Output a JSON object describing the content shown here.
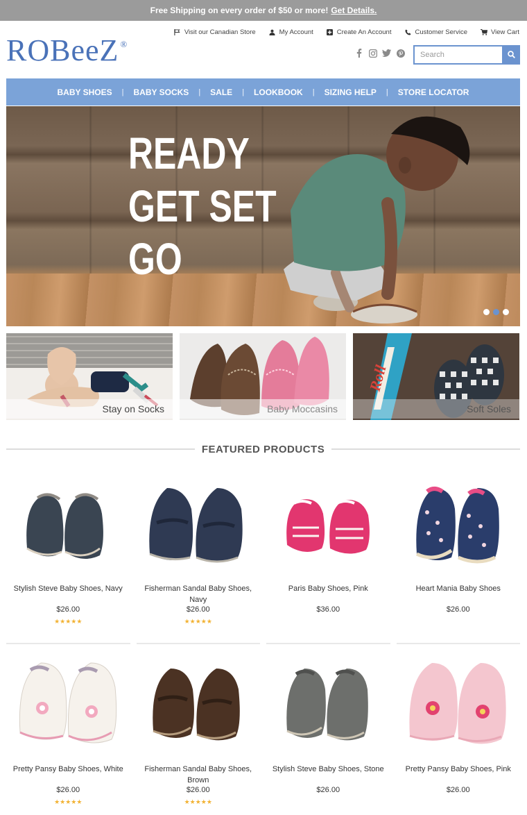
{
  "promo": {
    "text": "Free Shipping on every order of $50 or more!",
    "link": "Get Details."
  },
  "header": {
    "logo": "ROBeeZ",
    "logo_mark": "®",
    "utility_links": [
      {
        "label": "Visit our Canadian Store",
        "icon": "flag-icon"
      },
      {
        "label": "My Account",
        "icon": "user-icon"
      },
      {
        "label": "Create An Account",
        "icon": "plus-square-icon"
      },
      {
        "label": "Customer Service",
        "icon": "phone-icon"
      },
      {
        "label": "View Cart",
        "icon": "cart-icon"
      }
    ],
    "social": [
      "facebook-icon",
      "instagram-icon",
      "twitter-icon",
      "pinterest-icon"
    ],
    "search": {
      "placeholder": "Search"
    }
  },
  "nav": {
    "items": [
      "BABY SHOES",
      "BABY SOCKS",
      "SALE",
      "LOOKBOOK",
      "SIZING HELP",
      "STORE LOCATOR"
    ]
  },
  "hero": {
    "lines": [
      "READY",
      "GET SET",
      "GO"
    ],
    "slides": 3,
    "active_slide": 2
  },
  "categories": [
    {
      "label": "Stay on Socks"
    },
    {
      "label": "Baby Moccasins"
    },
    {
      "label": "Soft Soles"
    }
  ],
  "featured": {
    "title": "FEATURED PRODUCTS",
    "products": [
      {
        "name": "Stylish Steve Baby Shoes, Navy",
        "price": "$26.00",
        "stars": "★★★★★"
      },
      {
        "name": "Fisherman Sandal Baby Shoes, Navy",
        "price": "$26.00",
        "stars": "★★★★★"
      },
      {
        "name": "Paris Baby Shoes, Pink",
        "price": "$36.00",
        "stars": ""
      },
      {
        "name": "Heart Mania Baby Shoes",
        "price": "$26.00",
        "stars": ""
      },
      {
        "name": "Pretty Pansy Baby Shoes, White",
        "price": "$26.00",
        "stars": "★★★★★"
      },
      {
        "name": "Fisherman Sandal Baby Shoes, Brown",
        "price": "$26.00",
        "stars": "★★★★★"
      },
      {
        "name": "Stylish Steve Baby Shoes, Stone",
        "price": "$26.00",
        "stars": ""
      },
      {
        "name": "Pretty Pansy Baby Shoes, Pink",
        "price": "$26.00",
        "stars": ""
      }
    ]
  },
  "colors": {
    "brand_blue": "#4a72b8",
    "nav_blue": "#7ba3d8",
    "promo_gray": "#9b9b9b",
    "star_gold": "#f2b233"
  }
}
